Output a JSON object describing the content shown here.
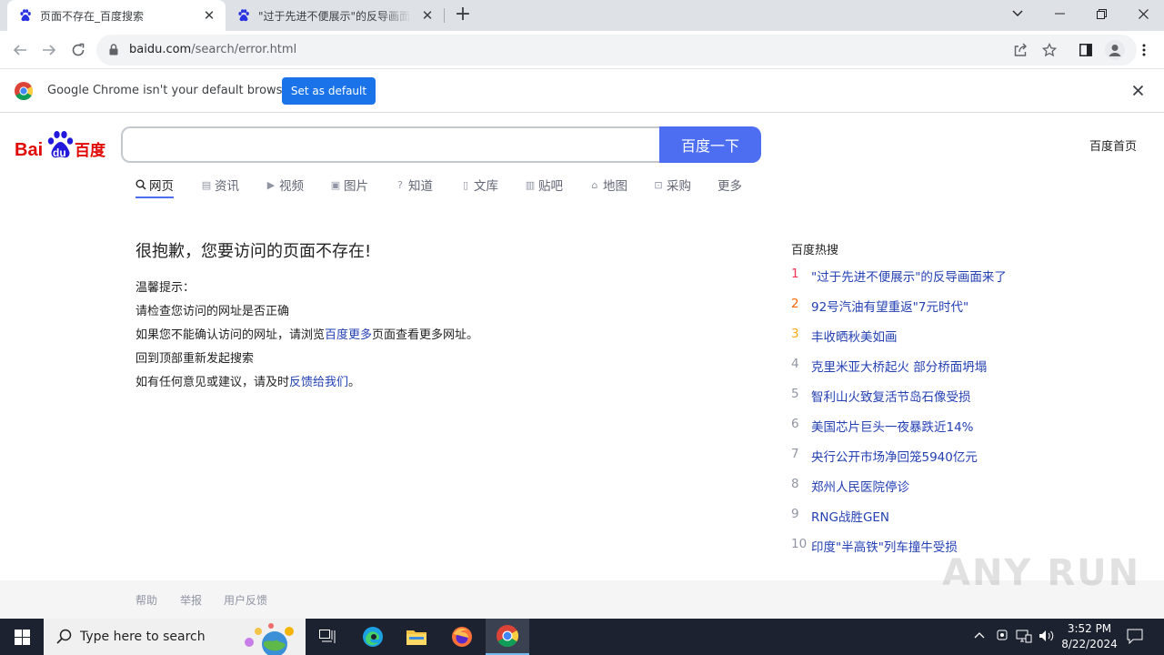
{
  "browser": {
    "tabs": [
      {
        "title": "页面不存在_百度搜索",
        "close": "✕"
      },
      {
        "title": "\"过于先进不便展示\"的反导画面来了",
        "close": "✕"
      }
    ],
    "new_tab": "+",
    "address": {
      "domain": "baidu.com",
      "path": "/search/error.html"
    },
    "infobar": {
      "message": "Google Chrome isn't your default browser",
      "button": "Set as default"
    }
  },
  "baidu": {
    "logo": {
      "text_left": "Bai",
      "text_mid": "du",
      "text_right": "百度"
    },
    "search_button": "百度一下",
    "home_link": "百度首页",
    "nav_tabs": [
      {
        "label": "网页",
        "icon": "search-icon"
      },
      {
        "label": "资讯",
        "icon": "news-icon"
      },
      {
        "label": "视频",
        "icon": "video-icon"
      },
      {
        "label": "图片",
        "icon": "image-icon"
      },
      {
        "label": "知道",
        "icon": "question-icon"
      },
      {
        "label": "文库",
        "icon": "document-icon"
      },
      {
        "label": "贴吧",
        "icon": "forum-icon"
      },
      {
        "label": "地图",
        "icon": "map-icon"
      },
      {
        "label": "采购",
        "icon": "purchase-icon"
      },
      {
        "label": "更多",
        "icon": ""
      }
    ],
    "error": {
      "title": "很抱歉，您要访问的页面不存在!",
      "tips_heading": "温馨提示：",
      "tip1": "请检查您访问的网址是否正确",
      "tip2_a": "如果您不能确认访问的网址，请浏览",
      "tip2_link": "百度更多",
      "tip2_b": "页面查看更多网址。",
      "tip3": "回到顶部重新发起搜索",
      "tip4_a": "如有任何意见或建议，请及时",
      "tip4_link": "反馈给我们",
      "tip4_b": "。"
    },
    "hot": {
      "title": "百度热搜",
      "items": [
        {
          "rank": "1",
          "text": "\"过于先进不便展示\"的反导画面来了"
        },
        {
          "rank": "2",
          "text": "92号汽油有望重返\"7元时代\""
        },
        {
          "rank": "3",
          "text": "丰收晒秋美如画"
        },
        {
          "rank": "4",
          "text": "克里米亚大桥起火 部分桥面坍塌"
        },
        {
          "rank": "5",
          "text": "智利山火致复活节岛石像受损"
        },
        {
          "rank": "6",
          "text": "美国芯片巨头一夜暴跌近14%"
        },
        {
          "rank": "7",
          "text": "央行公开市场净回笼5940亿元"
        },
        {
          "rank": "8",
          "text": "郑州人民医院停诊"
        },
        {
          "rank": "9",
          "text": "RNG战胜GEN"
        },
        {
          "rank": "10",
          "text": "印度\"半高铁\"列车撞牛受损"
        }
      ]
    },
    "footer": [
      "帮助",
      "举报",
      "用户反馈"
    ],
    "watermark": "ANY RUN"
  },
  "taskbar": {
    "search_placeholder": "Type here to search",
    "time": "3:52 PM",
    "date": "8/22/2024"
  },
  "colors": {
    "baidu_blue": "#4e6ef2",
    "link_blue": "#2440b3",
    "rank1": "#f63051",
    "rank2": "#ff6600",
    "rank3": "#faa90e"
  }
}
